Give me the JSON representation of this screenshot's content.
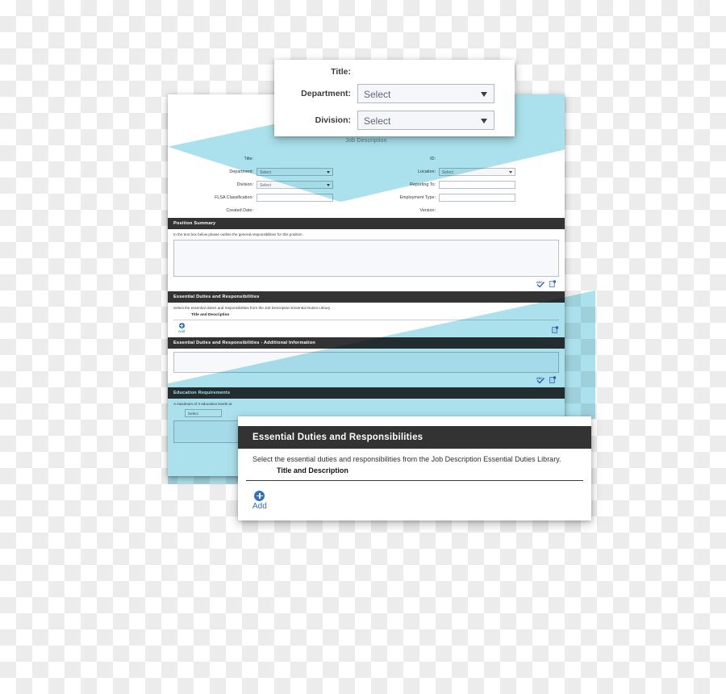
{
  "document": {
    "title": "Job Description",
    "fields_left": [
      {
        "label": "Title:",
        "type": "static",
        "value": ""
      },
      {
        "label": "Department:",
        "type": "select",
        "value": "Select"
      },
      {
        "label": "Division:",
        "type": "select",
        "value": "Select"
      },
      {
        "label": "FLSA Classification:",
        "type": "input",
        "value": ""
      },
      {
        "label": "Created Date:",
        "type": "static",
        "value": ""
      }
    ],
    "fields_right": [
      {
        "label": "ID:",
        "type": "static",
        "value": ""
      },
      {
        "label": "Location:",
        "type": "select",
        "value": "Select"
      },
      {
        "label": "Reporting To:",
        "type": "input",
        "value": ""
      },
      {
        "label": "Employment Type:",
        "type": "input",
        "value": ""
      },
      {
        "label": "Version:",
        "type": "static",
        "value": ""
      }
    ],
    "sections": {
      "position_summary": {
        "header": "Position Summary",
        "description": "In the text box below please outline the general responsibilities for this position.",
        "textarea_value": ""
      },
      "essential_duties": {
        "header": "Essential Duties and Responsibilities",
        "description": "Select the essential duties and responsibilities from the Job Description Essential Duties Library.",
        "subheader": "Title and Description",
        "add_label": "Add"
      },
      "essential_duties_additional": {
        "header": "Essential Duties and Responsibilities - Additional Information",
        "textarea_value": ""
      },
      "education_requirements": {
        "header": "Education Requirements",
        "description": "A maximum of 4 education levels ar",
        "select_value": "Select",
        "textarea_value": ""
      }
    },
    "icons": {
      "spellcheck": "spellcheck-icon",
      "copy": "copy-document-icon",
      "plus": "plus-circle-icon",
      "caret": "chevron-down-icon"
    }
  },
  "popup_top": {
    "fields": [
      {
        "label": "Title:",
        "type": "static",
        "value": ""
      },
      {
        "label": "Department:",
        "type": "select",
        "value": "Select"
      },
      {
        "label": "Division:",
        "type": "select",
        "value": "Select"
      }
    ]
  },
  "popup_bottom": {
    "header": "Essential Duties and Responsibilities",
    "description": "Select the essential duties and responsibilities from the Job Description Essential Duties Library.",
    "subheader": "Title and Description",
    "add_label": "Add"
  },
  "colors": {
    "header_dark": "#333333",
    "beam_cyan": "#78cfe0",
    "accent_blue": "#2f6fc4",
    "field_border": "#b9bfc4",
    "checker_gray": "#ececec"
  }
}
